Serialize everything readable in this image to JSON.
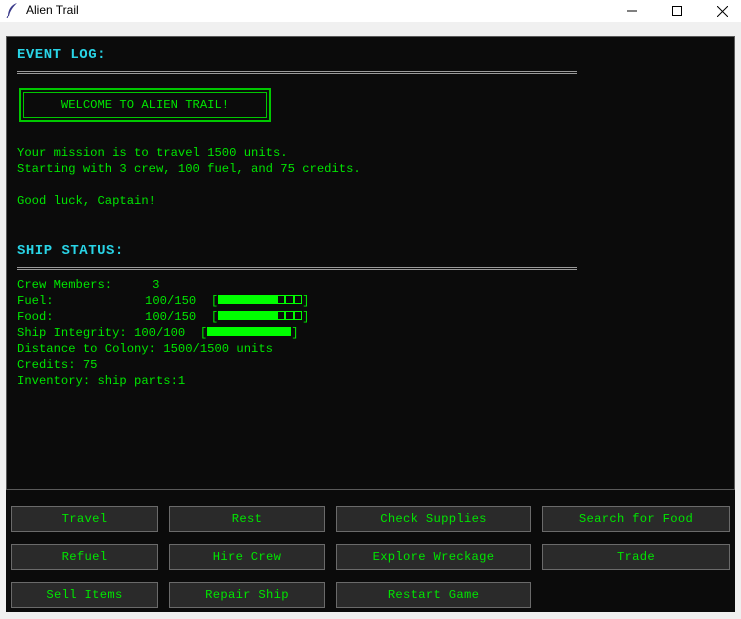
{
  "window": {
    "title": "Alien Trail",
    "controls": {
      "minimize": "minimize-icon",
      "maximize": "maximize-icon",
      "close": "close-icon"
    }
  },
  "colors": {
    "text": "#00e600",
    "heading": "#29d4e6",
    "background": "#0b0b0b",
    "button_bg": "#2a2a2a",
    "bar": "#00ff00"
  },
  "event_log": {
    "heading": "EVENT LOG:",
    "welcome": "WELCOME TO ALIEN TRAIL!",
    "lines": [
      "Your mission is to travel 1500 units.",
      "Starting with 3 crew, 100 fuel, and 75 credits.",
      "Good luck, Captain!"
    ]
  },
  "ship_status": {
    "heading": "SHIP STATUS:",
    "crew": {
      "label": "Crew Members:",
      "value": "3"
    },
    "fuel": {
      "label": "Fuel:",
      "value": "100/150",
      "fraction": 0.667
    },
    "food": {
      "label": "Food:",
      "value": "100/150",
      "fraction": 0.667
    },
    "integrity": {
      "label": "Ship Integrity:",
      "value": "100/100",
      "fraction": 1.0
    },
    "distance": "Distance to Colony: 1500/1500 units",
    "credits": "Credits: 75",
    "inventory": "Inventory: ship parts:1"
  },
  "buttons": [
    "Travel",
    "Rest",
    "Check Supplies",
    "Search for Food",
    "Refuel",
    "Hire Crew",
    "Explore Wreckage",
    "Trade",
    "Sell Items",
    "Repair Ship",
    "Restart Game"
  ]
}
